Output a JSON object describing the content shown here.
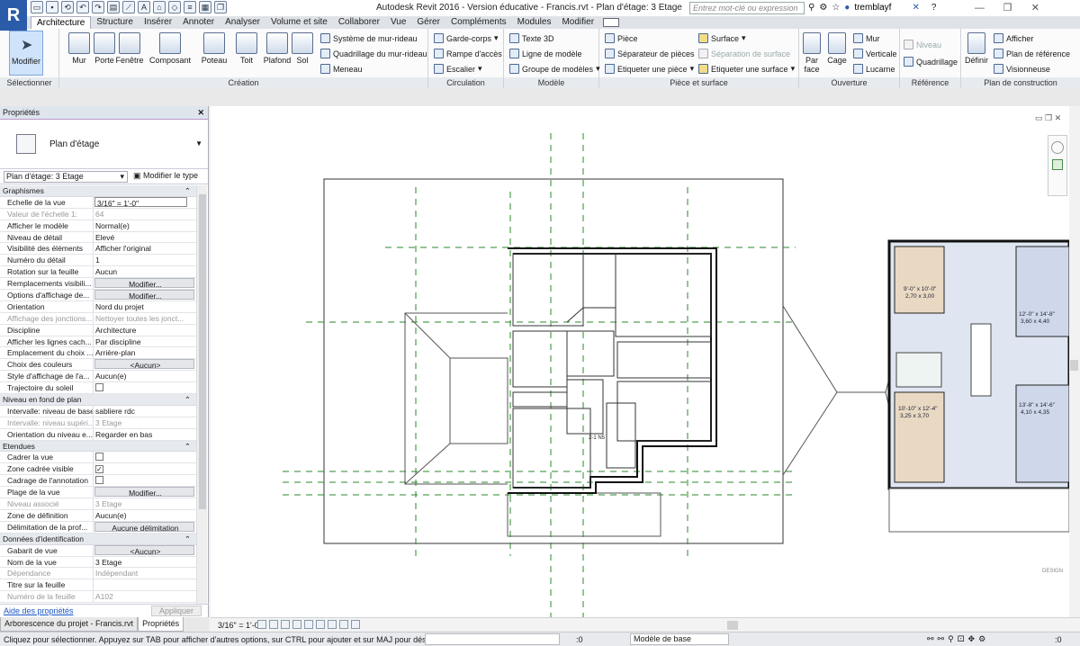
{
  "app": {
    "logo": "R",
    "title": "Autodesk Revit 2016 - Version éducative -    Francis.rvt - Plan d'étage: 3 Etage",
    "search_placeholder": "Entrez mot-clé ou expression",
    "user": "tremblayf"
  },
  "tabs": [
    "Architecture",
    "Structure",
    "Insérer",
    "Annoter",
    "Analyser",
    "Volume et site",
    "Collaborer",
    "Vue",
    "Gérer",
    "Compléments",
    "Modules",
    "Modifier"
  ],
  "ribbon": {
    "select": {
      "modify": "Modifier",
      "title": "Sélectionner"
    },
    "build": {
      "title": "Création",
      "buttons": [
        "Mur",
        "Porte",
        "Fenêtre",
        "Composant",
        "Poteau",
        "Toit",
        "Plafond",
        "Sol"
      ],
      "small": [
        "Système de mur-rideau",
        "Quadrillage du mur-rideau",
        "Meneau"
      ]
    },
    "circulation": {
      "title": "Circulation",
      "small": [
        "Garde-corps",
        "Rampe d'accès",
        "Escalier"
      ]
    },
    "model": {
      "title": "Modèle",
      "small": [
        "Texte 3D",
        "Ligne de modèle",
        "Groupe de modèles"
      ]
    },
    "room": {
      "title": "Pièce et surface",
      "left": [
        "Pièce",
        "Séparateur de pièces",
        "Etiqueter une pièce"
      ],
      "right": [
        "Surface",
        "Séparation de surface",
        "Etiqueter une surface"
      ]
    },
    "opening": {
      "title": "Ouverture",
      "big": [
        "Par face",
        "Cage"
      ],
      "small": [
        "Mur",
        "Verticale",
        "Lucarne"
      ]
    },
    "datum": {
      "title": "Référence",
      "small": [
        "Niveau",
        "Quadrillage"
      ]
    },
    "workplane": {
      "title": "Plan de construction",
      "big": "Définir",
      "small": [
        "Afficher",
        "Plan de référence",
        "Visionneuse"
      ]
    }
  },
  "properties": {
    "title": "Propriétés",
    "type_name": "Plan d'étage",
    "instance": "Plan d'étage: 3 Etage",
    "edit_type": "Modifier le type",
    "help": "Aide des propriétés",
    "apply": "Appliquer",
    "rows": [
      {
        "kind": "section",
        "label": "Graphismes"
      },
      {
        "label": "Echelle de la vue",
        "value": "3/16\" = 1'-0\"",
        "style": "boxed"
      },
      {
        "label": "Valeur de l'échelle   1:",
        "value": "64",
        "style": "dim"
      },
      {
        "label": "Afficher le modèle",
        "value": "Normal(e)"
      },
      {
        "label": "Niveau de détail",
        "value": "Elevé"
      },
      {
        "label": "Visibilité des éléments",
        "value": "Afficher l'original"
      },
      {
        "label": "Numéro du détail",
        "value": "1"
      },
      {
        "label": "Rotation sur la feuille",
        "value": "Aucun"
      },
      {
        "label": "Remplacements visibili...",
        "value": "Modifier...",
        "style": "btn"
      },
      {
        "label": "Options d'affichage de...",
        "value": "Modifier...",
        "style": "btn"
      },
      {
        "label": "Orientation",
        "value": "Nord du projet"
      },
      {
        "label": "Affichage des jonctions...",
        "value": "Nettoyer toutes les jonct...",
        "style": "dim"
      },
      {
        "label": "Discipline",
        "value": "Architecture"
      },
      {
        "label": "Afficher les lignes cach...",
        "value": "Par discipline"
      },
      {
        "label": "Emplacement du choix ...",
        "value": "Arrière-plan"
      },
      {
        "label": "Choix des couleurs",
        "value": "<Aucun>",
        "style": "btn"
      },
      {
        "label": "Style d'affichage de l'a...",
        "value": "Aucun(e)"
      },
      {
        "label": "Trajectoire du soleil",
        "check": false
      },
      {
        "kind": "section",
        "label": "Niveau en fond de plan"
      },
      {
        "label": "Intervalle: niveau de base",
        "value": "sabliere rdc"
      },
      {
        "label": "Intervalle: niveau supéri...",
        "value": "3 Etage",
        "style": "dim"
      },
      {
        "label": "Orientation du niveau e...",
        "value": "Regarder en bas"
      },
      {
        "kind": "section",
        "label": "Etendues"
      },
      {
        "label": "Cadrer la vue",
        "check": false
      },
      {
        "label": "Zone cadrée visible",
        "check": true
      },
      {
        "label": "Cadrage de l'annotation",
        "check": false
      },
      {
        "label": "Plage de la vue",
        "value": "Modifier...",
        "style": "btn"
      },
      {
        "label": "Niveau associé",
        "value": "3 Etage",
        "style": "dim"
      },
      {
        "label": "Zone de définition",
        "value": "Aucun(e)"
      },
      {
        "label": "Délimitation de la prof...",
        "value": "Aucune délimitation",
        "style": "btn"
      },
      {
        "kind": "section",
        "label": "Données d'identification"
      },
      {
        "label": "Gabarit de vue",
        "value": "<Aucun>",
        "style": "btn"
      },
      {
        "label": "Nom de la vue",
        "value": "3 Etage"
      },
      {
        "label": "Dépendance",
        "value": "Indépendant",
        "style": "dim"
      },
      {
        "label": "Titre sur la feuille",
        "value": ""
      },
      {
        "label": "Numéro de la feuille",
        "value": "A102",
        "style": "dim"
      }
    ]
  },
  "palette_tabs": [
    "Arborescence du projet - Francis.rvt",
    "Propriétés"
  ],
  "view": {
    "scale": "3/16\" = 1'-0\"",
    "room_labels": [
      "9'-0\" x 10'-0\"",
      "2,70 x 3,00",
      "12'-0\" x 14'-8\"",
      "3,60 x 4,40",
      "10'-10\" x 12'-4\"",
      "3,25 x 3,70",
      "13'-8\" x 14'-6\"",
      "4,10 x 4,35"
    ],
    "tag": "2-1 N5",
    "brand": "DESIGN"
  },
  "status": {
    "text": "Cliquez pour sélectionner. Appuyez sur TAB pour afficher d'autres options, sur CTRL pour ajouter et sur MAJ pour désact",
    "zero": ":0",
    "model": "Modèle de base",
    "filter": ":0"
  }
}
